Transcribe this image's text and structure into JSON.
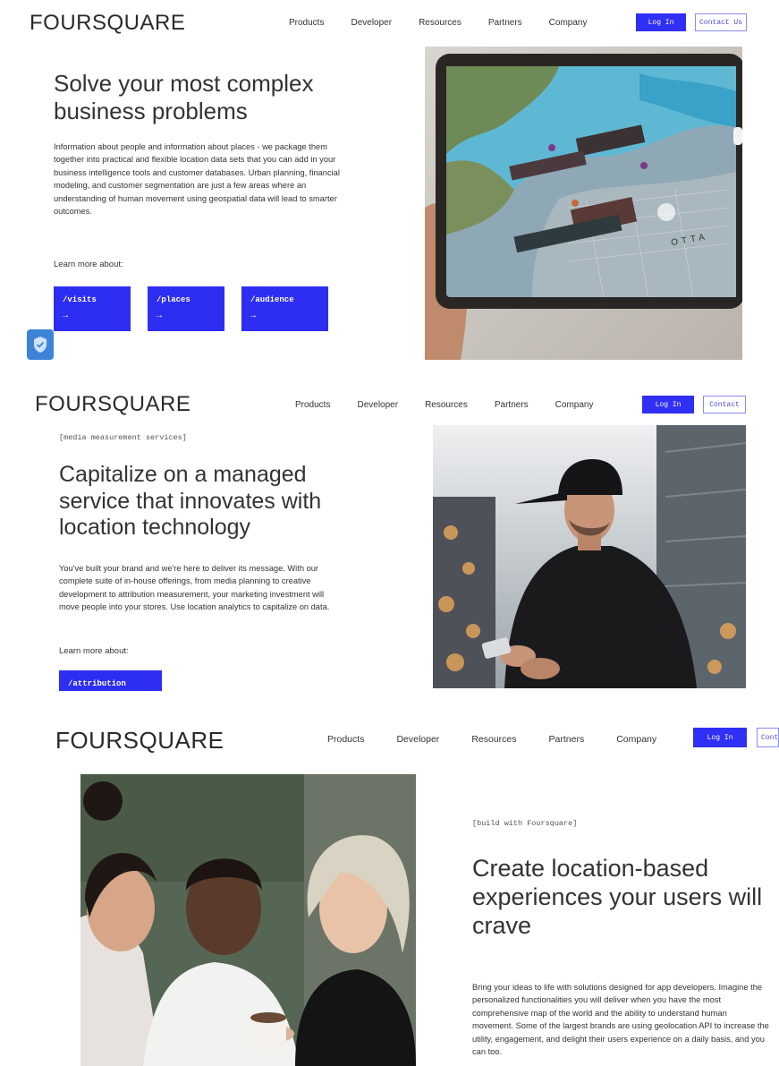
{
  "brand": {
    "logo": "FOURSQUARE",
    "accent": "#2f2ff5"
  },
  "nav": {
    "items": [
      "Products",
      "Developer",
      "Resources",
      "Partners",
      "Company"
    ],
    "login": "Log In"
  },
  "section1": {
    "contact": "Contact Us",
    "headline_line1": "Solve your most complex",
    "headline_line2": "business problems",
    "body": "Information about people and information about places - we package them together into practical and flexible location data sets that you can add in your business intelligence tools and customer databases. Urban planning, financial modeling, and customer segmentation are just a few areas where an understanding of human movement using geospatial data will lead to smarter outcomes.",
    "learn_more": "Learn more about:",
    "buttons": [
      "/visits",
      "/places",
      "/audience"
    ],
    "arrow": "→",
    "map_label": "OTTA"
  },
  "section2": {
    "contact": "Contact",
    "tag": "[media measurement services]",
    "headline_line1": "Capitalize on a managed",
    "headline_line2": "service that innovates with",
    "headline_line3": "location technology",
    "body": "You've built your brand and we're here to deliver its message. With our complete suite of in-house offerings, from media planning to creative development to attribution measurement, your marketing investment will move people into your stores. Use location analytics to capitalize on data.",
    "learn_more": "Learn more about:",
    "button": "/attribution"
  },
  "section3": {
    "contact": "Cont",
    "tag": "[build with Foursquare]",
    "headline_line1": "Create location-based",
    "headline_line2": "experiences your users will",
    "headline_line3": "crave",
    "body": "Bring your ideas to life with solutions designed for app developers. Imagine the personalized functionalities you will deliver when you have the most comprehensive map of the world and the ability to understand human movement. Some of the largest brands are using geolocation API to increase the utility, engagement, and delight their users experience on a daily basis, and you can too."
  }
}
